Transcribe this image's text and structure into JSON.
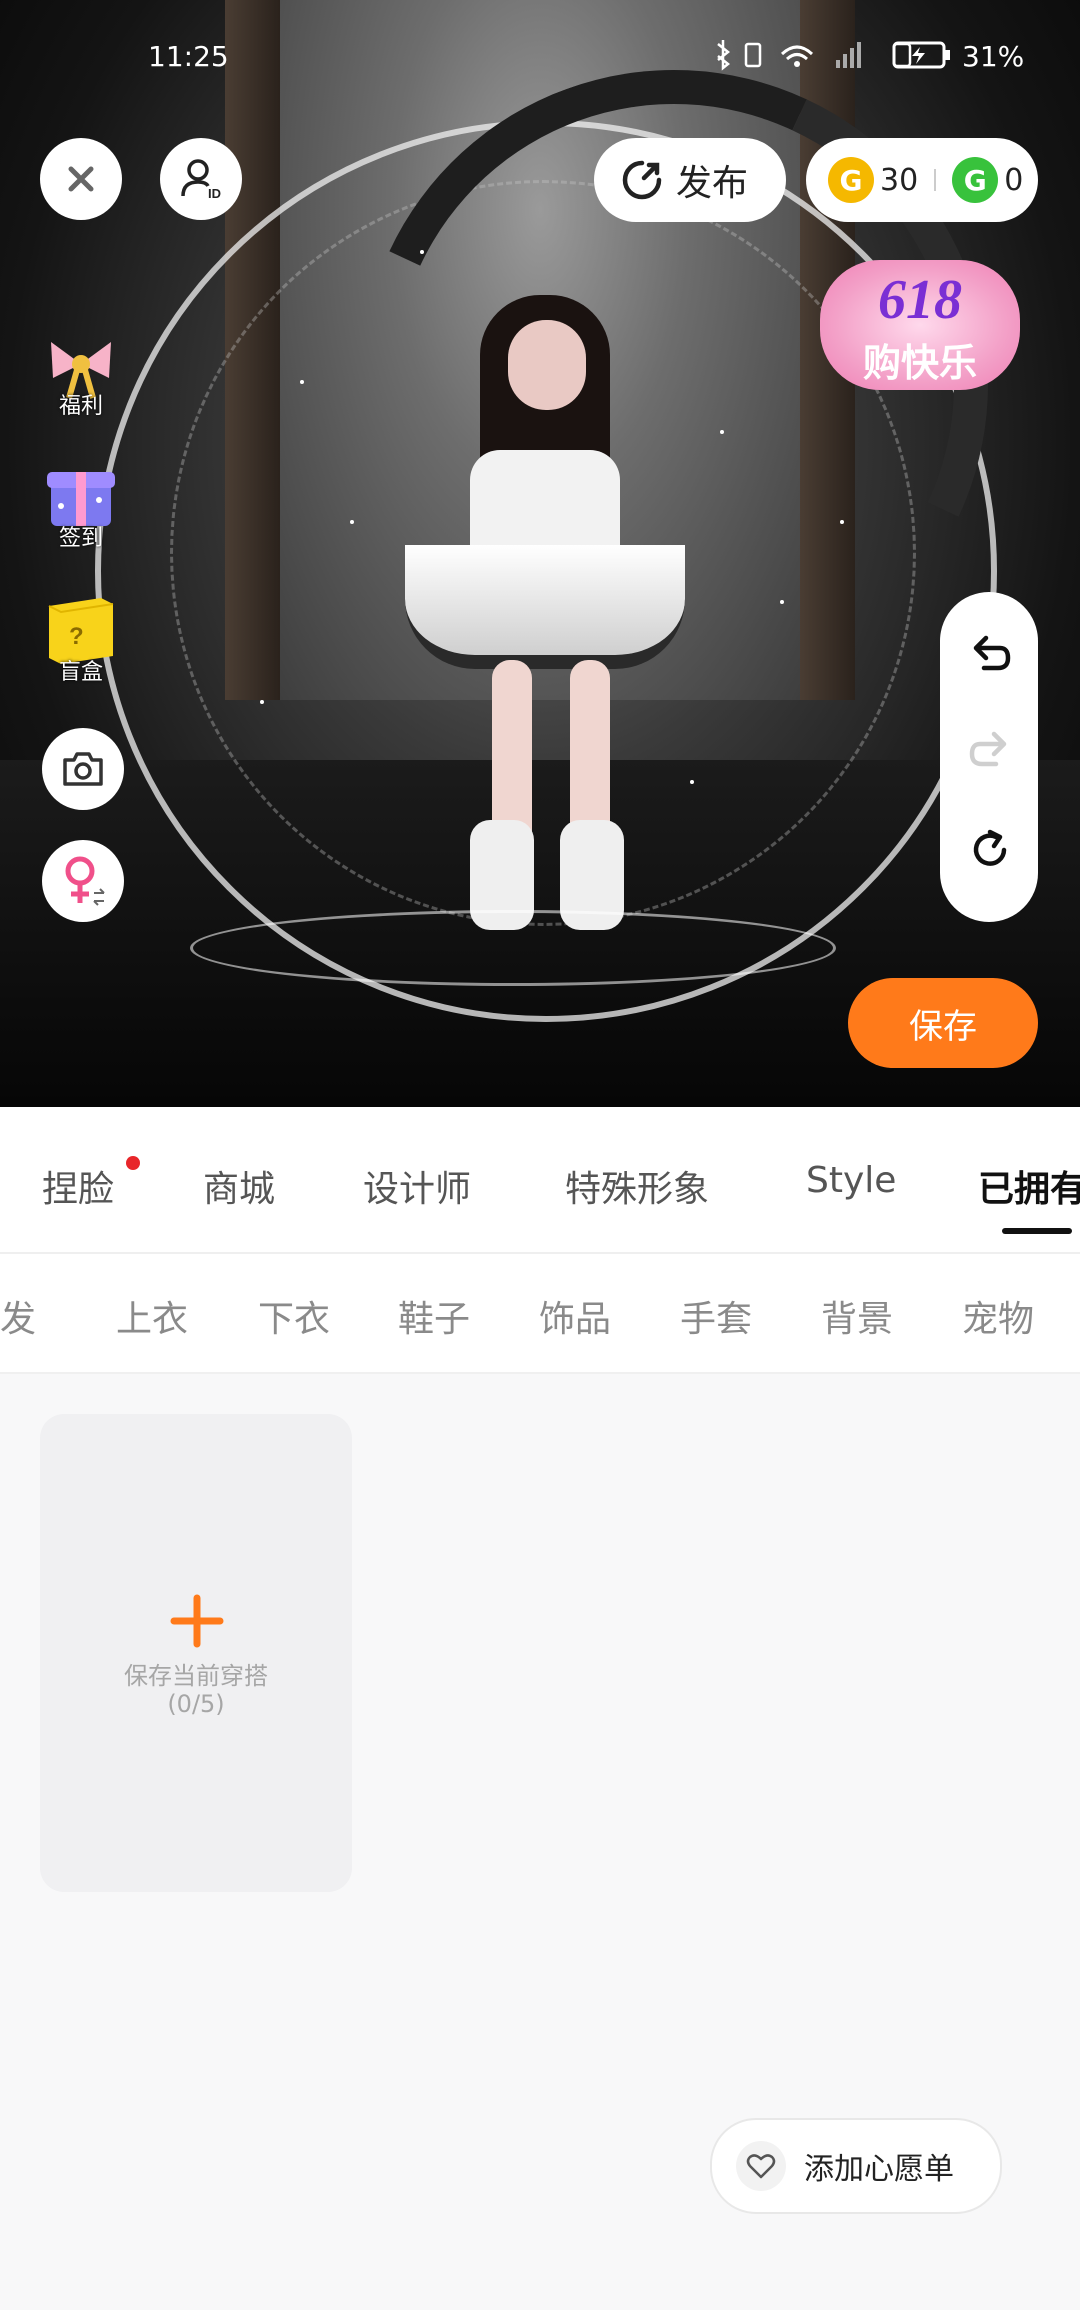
{
  "status_bar": {
    "time": "11:25",
    "battery": "31%"
  },
  "top_controls": {
    "publish_label": "发布",
    "currency_gold": "30",
    "currency_green": "0",
    "coin_glyph": "G"
  },
  "promo": {
    "line1": "618",
    "line2": "购快乐"
  },
  "side_menu": {
    "welfare": "福利",
    "checkin": "签到",
    "blindbox": "盲盒"
  },
  "save_label": "保存",
  "tabs": [
    {
      "label": "捏脸"
    },
    {
      "label": "商城"
    },
    {
      "label": "设计师"
    },
    {
      "label": "特殊形象"
    },
    {
      "label": "Style"
    },
    {
      "label": "已拥有"
    }
  ],
  "subtabs": [
    {
      "label": "头发"
    },
    {
      "label": "上衣"
    },
    {
      "label": "下衣"
    },
    {
      "label": "鞋子"
    },
    {
      "label": "饰品"
    },
    {
      "label": "手套"
    },
    {
      "label": "背景"
    },
    {
      "label": "宠物"
    }
  ],
  "outfit_card": {
    "title": "保存当前穿搭",
    "count": "(0/5)"
  },
  "wishlist_label": "添加心愿单",
  "colors": {
    "accent": "#ff7a1a",
    "badge_red": "#e8262a",
    "gold": "#f5b800",
    "green": "#38c23c"
  },
  "icons": [
    "close-icon",
    "id-card-icon",
    "publish-icon",
    "coin-icon",
    "gift-icon",
    "camera-icon",
    "gender-switch-icon",
    "undo-icon",
    "redo-icon",
    "reset-icon",
    "plus-icon",
    "heart-icon"
  ]
}
